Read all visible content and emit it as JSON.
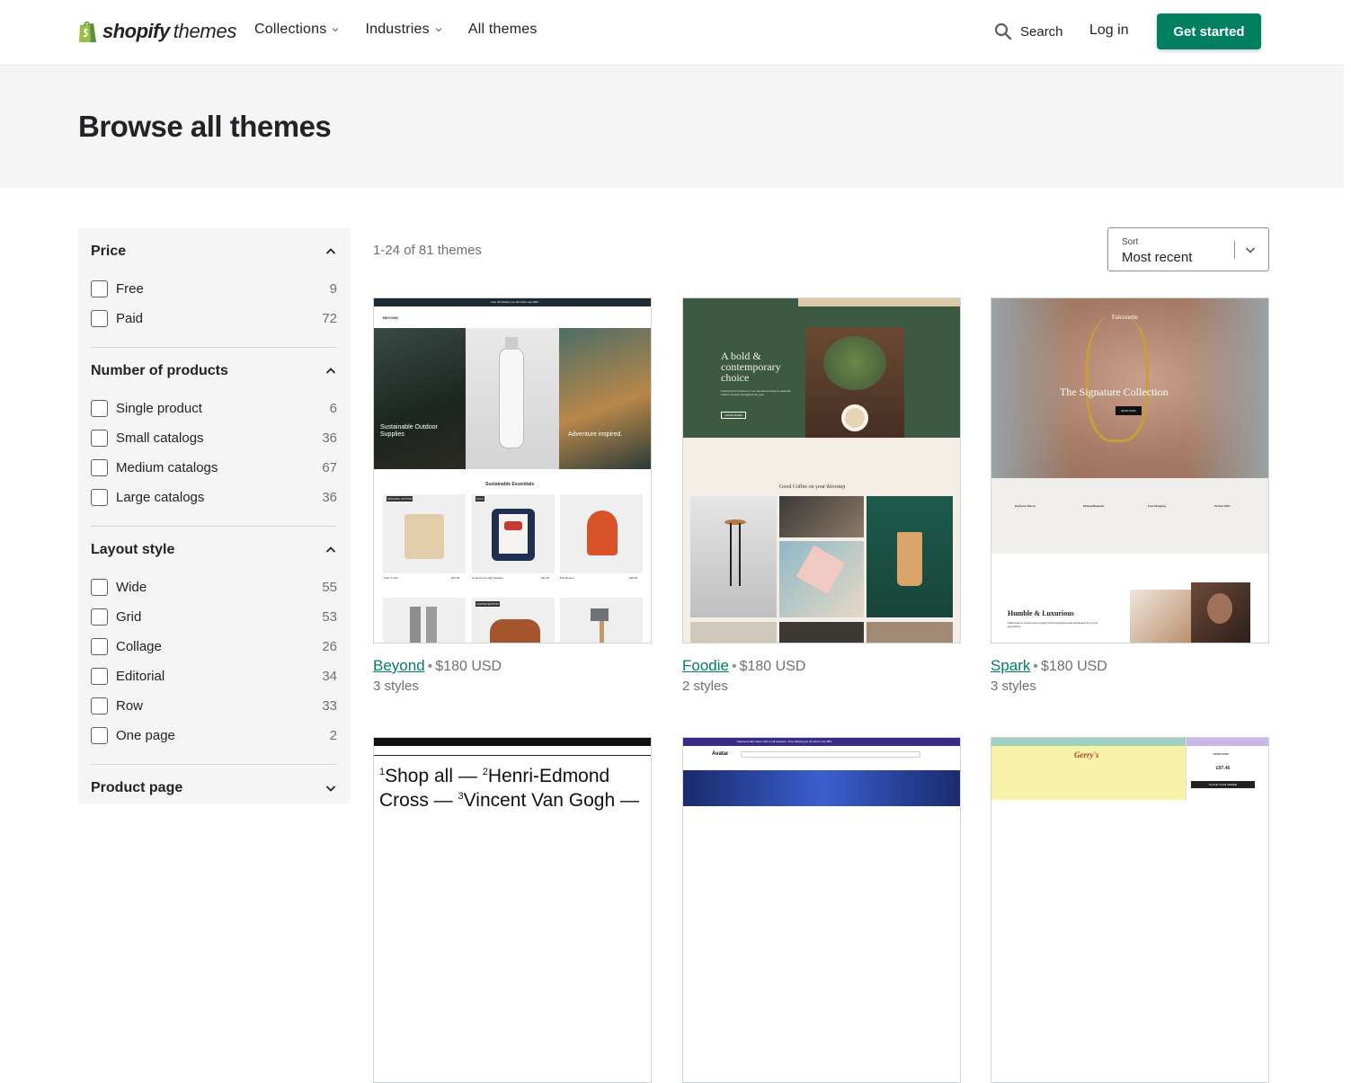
{
  "header": {
    "logo_word": "shopify",
    "logo_sub": "themes",
    "nav": [
      {
        "label": "Collections",
        "has_dropdown": true
      },
      {
        "label": "Industries",
        "has_dropdown": true
      },
      {
        "label": "All themes",
        "has_dropdown": false
      }
    ],
    "search_label": "Search",
    "login_label": "Log in",
    "cta_label": "Get started"
  },
  "hero": {
    "title": "Browse all themes"
  },
  "filters": [
    {
      "title": "Price",
      "expanded": true,
      "options": [
        {
          "label": "Free",
          "count": "9"
        },
        {
          "label": "Paid",
          "count": "72"
        }
      ]
    },
    {
      "title": "Number of products",
      "expanded": true,
      "options": [
        {
          "label": "Single product",
          "count": "6"
        },
        {
          "label": "Small catalogs",
          "count": "36"
        },
        {
          "label": "Medium catalogs",
          "count": "67"
        },
        {
          "label": "Large catalogs",
          "count": "36"
        }
      ]
    },
    {
      "title": "Layout style",
      "expanded": true,
      "options": [
        {
          "label": "Wide",
          "count": "55"
        },
        {
          "label": "Grid",
          "count": "53"
        },
        {
          "label": "Collage",
          "count": "26"
        },
        {
          "label": "Editorial",
          "count": "34"
        },
        {
          "label": "Row",
          "count": "33"
        },
        {
          "label": "One page",
          "count": "2"
        }
      ]
    },
    {
      "title": "Product page",
      "expanded": false,
      "options": []
    }
  ],
  "results": {
    "count_text": "1-24 of 81 themes",
    "sort_label": "Sort",
    "sort_value": "Most recent"
  },
  "themes": [
    {
      "name": "Beyond",
      "price": "$180 USD",
      "styles": "3 styles",
      "preview": {
        "promo": "Free US Delivery on all orders over $50",
        "brand": "BEYOND",
        "hero_caption_left": "Sustainable Outdoor Supplies",
        "hero_caption_right": "Adventure inspired.",
        "section_title": "Sustainable Essentials",
        "tag_1": "ORGANIC COTTON",
        "tag_2": "SALE",
        "tag_3": "LIMITED EDITION",
        "p1": "Palm T-shirt",
        "p2": "Head for the Hills Sweater",
        "p3": "Bob Beanie",
        "p1_price": "£40.00",
        "p2_price": "£32.00",
        "p3_price": "£38.00"
      }
    },
    {
      "name": "Foodie",
      "price": "$180 USD",
      "styles": "2 styles",
      "preview": {
        "headline": "A bold & contemporary choice",
        "sub": "Featuring the Freshest in our expanded range of seasonal coffees sourced throughout the year",
        "cta": "LEARN MORE",
        "section": "Good Coffee on your doorstep"
      }
    },
    {
      "name": "Spark",
      "price": "$180 USD",
      "styles": "3 styles",
      "preview": {
        "brand": "Falconette",
        "hero": "The Signature Collection",
        "cta": "SHOP NOW",
        "col1": "Heirloom Pieces",
        "col2": "Ethical Materials",
        "col3": "Free Shipping",
        "col4": "Perfect Gifts",
        "sub_title": "Humble & Luxurious",
        "sub_text": "Falconette is a new luxury jewelry brand designed and developed for a new generation."
      }
    },
    {
      "name": "",
      "price": "",
      "styles": "",
      "preview": {
        "headline_1": "Shop all —",
        "headline_2": "Henri-Edmond",
        "headline_3": "Cross —",
        "headline_4": "Vincent Van Gogh —",
        "sup_1": "1",
        "sup_2": "2",
        "sup_3": "3"
      }
    },
    {
      "name": "",
      "price": "",
      "styles": "",
      "preview": {
        "brand": "Avatar",
        "banner": "Seasonal sale! Save 10% on all sweaters. Free shipping for all orders over $50."
      }
    },
    {
      "name": "",
      "price": "",
      "styles": "",
      "preview": {
        "brand": "Gerry's",
        "cart_title": "YOUR CART",
        "cart_total": "£97.46",
        "cart_cta": "PLACE YOUR ORDER"
      }
    }
  ],
  "colors": {
    "brand_green": "#008060",
    "hero_bg": "#f5f5f5",
    "sidebar_bg": "#f5f5f5",
    "text": "#212326",
    "muted": "#6d7175"
  }
}
